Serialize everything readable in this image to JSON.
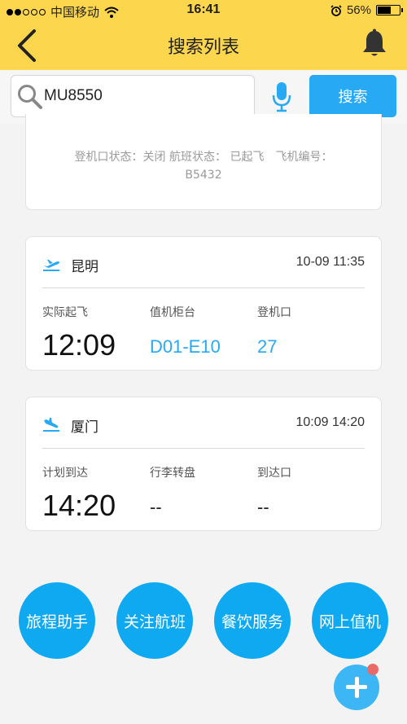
{
  "status_bar": {
    "carrier": "中国移动",
    "time": "16:41",
    "battery": "56%",
    "battery_level": 0.56,
    "signal_icon": "signal-dots-icon",
    "wifi_icon": "wifi-icon",
    "alarm_icon": "alarm-clock-icon"
  },
  "header": {
    "title": "搜索列表",
    "back_icon": "back-chevron-icon",
    "bell_icon": "bell-icon",
    "bg_color": "#fcd64d"
  },
  "search": {
    "value": "MU8550",
    "placeholder": "",
    "button_label": "搜索",
    "accent": "#27a9f4"
  },
  "partial_card": {
    "info": "登机口状态：关闭 航班状态： 已起飞　飞机编号：B5432"
  },
  "departure": {
    "icon": "plane-takeoff-icon",
    "city": "昆明",
    "datetime": "10-09 11:35",
    "col1_label": "实际起飞",
    "col1_value": "12:09",
    "col2_label": "值机柜台",
    "col2_value": "D01-E10",
    "col3_label": "登机口",
    "col3_value": "27"
  },
  "arrival": {
    "icon": "plane-landing-icon",
    "city": "厦门",
    "datetime": "10:09 14:20",
    "col1_label": "计划到达",
    "col1_value": "14:20",
    "col2_label": "行李转盘",
    "col2_value": "--",
    "col3_label": "到达口",
    "col3_value": "--"
  },
  "services": [
    "旅程助手",
    "关注航班",
    "餐饮服务",
    "网上值机"
  ],
  "fab": {
    "icon": "plus-icon",
    "badge_color": "#ea6a6a"
  }
}
